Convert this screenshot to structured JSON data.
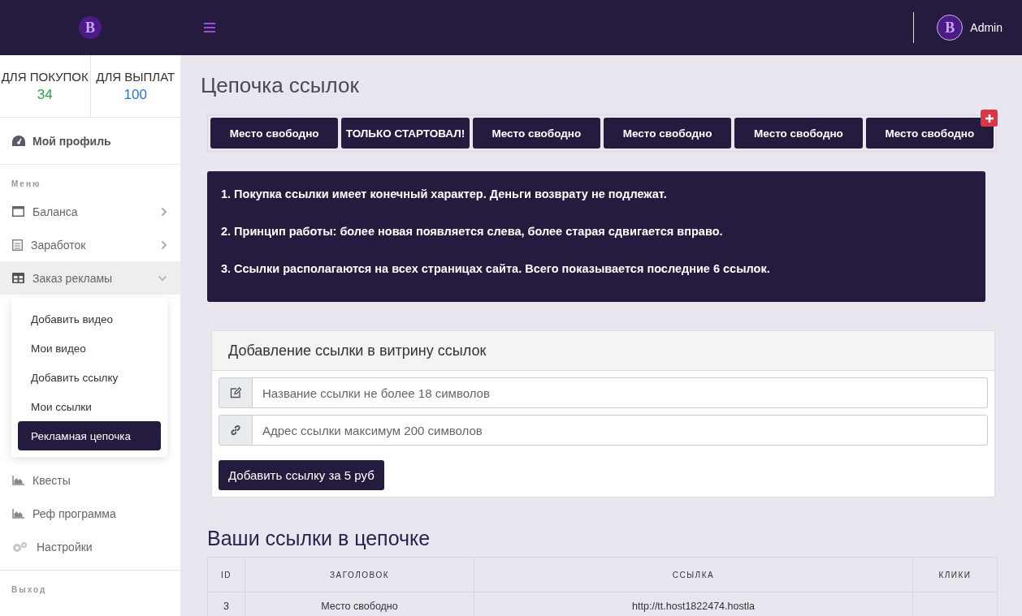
{
  "header": {
    "logo_letter": "B",
    "user": {
      "avatar_letter": "B",
      "name": "Admin"
    }
  },
  "sidebar": {
    "balances": [
      {
        "label": "ДЛЯ ПОКУПОК",
        "value": "34",
        "color": "#28a745"
      },
      {
        "label": "ДЛЯ ВЫПЛАТ",
        "value": "100",
        "color": "#1a73e8"
      }
    ],
    "profile": "Мой профиль",
    "menu_heading": "Меню",
    "items": [
      {
        "label": "Баланса",
        "kind": "card",
        "expanded": false
      },
      {
        "label": "Заработок",
        "kind": "calendar",
        "expanded": false
      },
      {
        "label": "Заказ рекламы",
        "kind": "table",
        "expanded": true,
        "children": [
          {
            "label": "Добавить видео",
            "selected": false
          },
          {
            "label": "Мои видео",
            "selected": false
          },
          {
            "label": "Добавить ссылку",
            "selected": false
          },
          {
            "label": "Мои ссылки",
            "selected": false
          },
          {
            "label": "Рекламная цепочка",
            "selected": true
          }
        ]
      },
      {
        "label": "Квесты",
        "kind": "chart"
      },
      {
        "label": "Реф программа",
        "kind": "chart"
      },
      {
        "label": "Настройки",
        "kind": "gears"
      }
    ],
    "logout": "Выход"
  },
  "page_title": "Цепочка ссылок",
  "chain_links": [
    "Место свободно",
    "ТОЛЬКО СТАРТОВАЛ!",
    "Место свободно",
    "Место свободно",
    "Место свободно",
    "Место свободно"
  ],
  "rules": [
    "1. Покупка ссылки имеет конечный характер. Деньги возврату не подлежат.",
    "2. Принцип работы: более новая появляется слева, более старая сдвигается вправо.",
    "3. Ссылки располагаются на всех страницах сайта. Всего показывается последние 6 ссылок."
  ],
  "form": {
    "title": "Добавление ссылки в витрину ссылок",
    "fields": [
      {
        "kind": "name",
        "placeholder": "Название ссылки не более 18 символов"
      },
      {
        "kind": "url",
        "placeholder": "Адрес ссылки максимум 200 символов"
      }
    ],
    "submit": "Добавить ссылку за 5 руб"
  },
  "table": {
    "title": "Ваши ссылки в цепочке",
    "columns": [
      "ID",
      "ЗАГОЛОВОК",
      "ССЫЛКА",
      "КЛИКИ"
    ],
    "rows": [
      [
        "3",
        "Место свободно",
        "http://tt.host1822474.hostla",
        ""
      ]
    ]
  }
}
